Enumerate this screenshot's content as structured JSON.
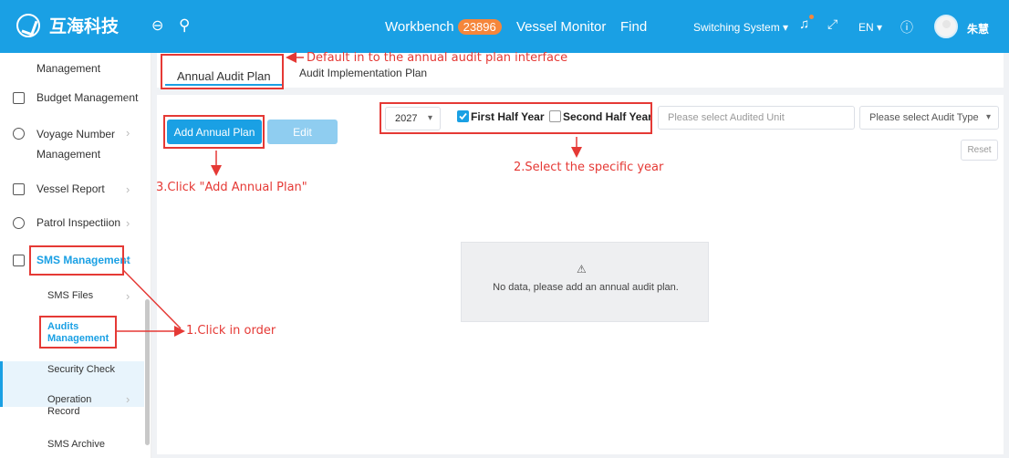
{
  "header": {
    "logo_text": "互海科技",
    "nav": {
      "workbench": "Workbench",
      "workbench_badge": "23896",
      "vessel_monitor": "Vessel Monitor",
      "find": "Find"
    },
    "switching_system": "Switching System ▾",
    "language": "EN ▾",
    "user_name": "朱慧"
  },
  "sidebar": {
    "items": [
      {
        "label": "Management"
      },
      {
        "label": "Budget Management",
        "icon": "budget-icon"
      },
      {
        "label": "Voyage Number",
        "label2": "Management",
        "icon": "globe-icon"
      },
      {
        "label": "Vessel Report",
        "icon": "report-icon"
      },
      {
        "label": "Patrol Inspectiion",
        "icon": "check-circle-icon"
      },
      {
        "label": "SMS Management",
        "icon": "document-icon"
      }
    ],
    "sub_items": [
      {
        "label": "SMS Files"
      },
      {
        "label": "Audits",
        "label2": "Management"
      },
      {
        "label": "Security Check"
      },
      {
        "label": "Operation",
        "label2": "Record"
      },
      {
        "label": "SMS Archive"
      }
    ]
  },
  "tabs": {
    "annual_audit_plan": "Annual Audit Plan",
    "audit_implementation_plan": "Audit Implementation Plan"
  },
  "toolbar": {
    "add_annual_plan": "Add Annual Plan",
    "edit": "Edit",
    "year": "2027",
    "first_half": "First Half Year",
    "second_half": "Second Half Year",
    "audited_unit_placeholder": "Please select Audited Unit",
    "audit_type_placeholder": "Please select Audit Type",
    "reset": "Reset"
  },
  "empty_state": {
    "icon": "⚠",
    "message": "No data, please add an annual audit plan."
  },
  "annotations": {
    "note_default": "Default in to the annual audit plan interface",
    "note_step1": "1.Click in order",
    "note_step2": "2.Select the specific year",
    "note_step3": "3.Click \"Add Annual Plan\""
  },
  "colors": {
    "primary": "#1aa0e4",
    "badge": "#f5863b",
    "annotation": "#e53935"
  }
}
